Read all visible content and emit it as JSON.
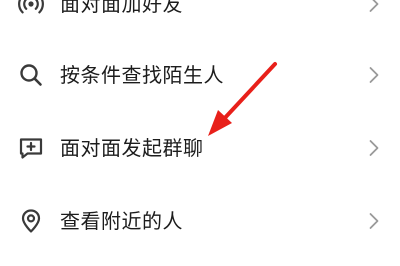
{
  "menu": {
    "items": [
      {
        "label": "面对面加好友",
        "icon": "radar-icon"
      },
      {
        "label": "按条件查找陌生人",
        "icon": "search-icon"
      },
      {
        "label": "面对面发起群聊",
        "icon": "chat-plus-icon"
      },
      {
        "label": "查看附近的人",
        "icon": "location-pin-icon"
      }
    ]
  },
  "colors": {
    "text": "#1c1c1c",
    "icon": "#3a3a3a",
    "chevron": "#9a9a9a",
    "annotation_arrow": "#e8201a"
  }
}
